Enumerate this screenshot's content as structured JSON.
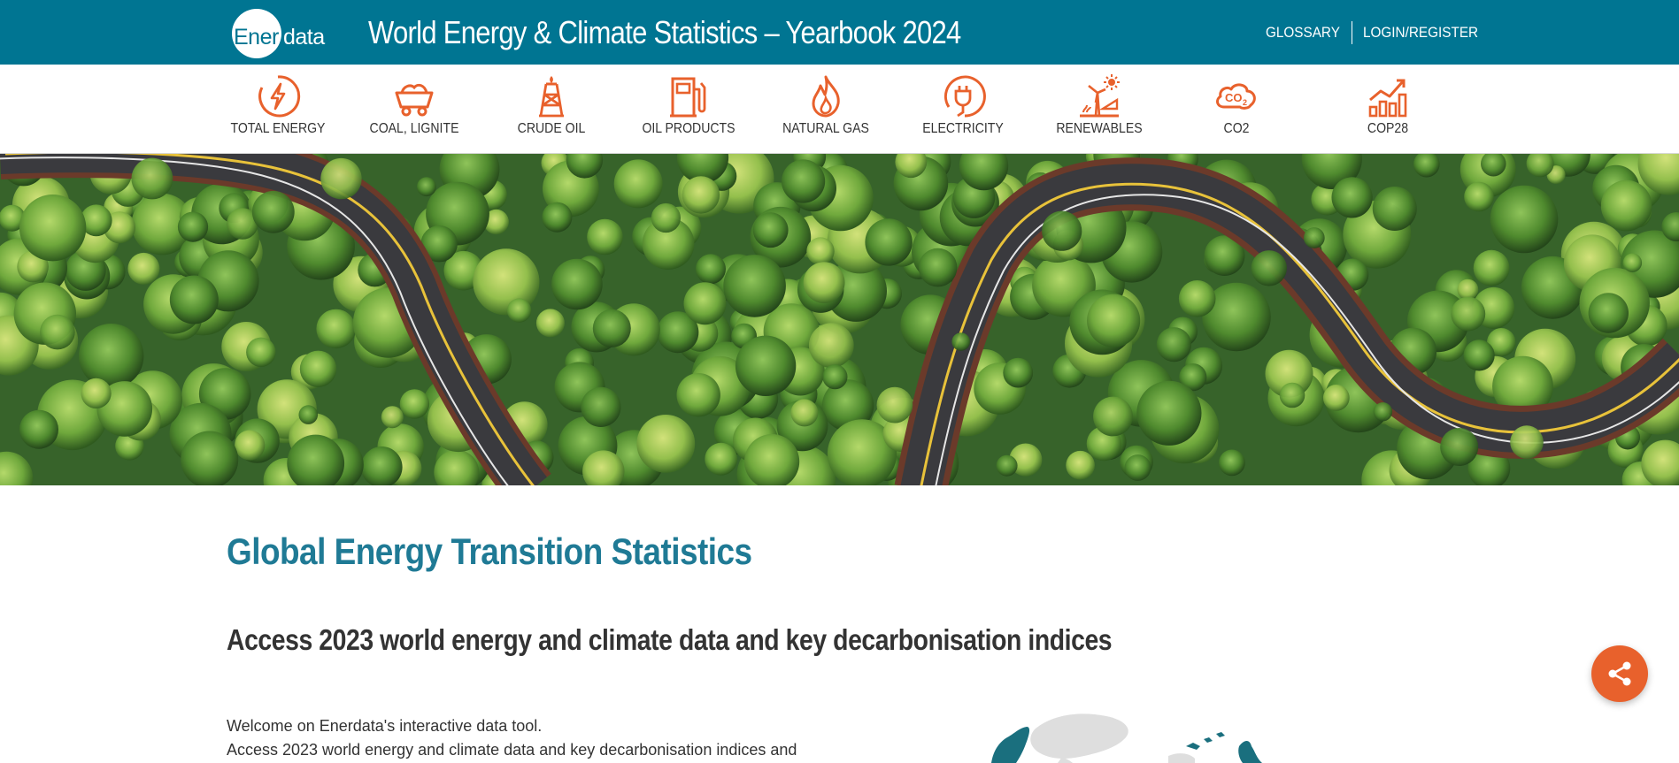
{
  "header": {
    "logo": {
      "text_left": "Ener",
      "text_right": "data"
    },
    "title": "World Energy & Climate Statistics – Yearbook 2024",
    "links": [
      {
        "label": "GLOSSARY"
      },
      {
        "label": "LOGIN/REGISTER"
      }
    ]
  },
  "categories": [
    {
      "label": "TOTAL ENERGY",
      "icon": "lightning-circle-icon"
    },
    {
      "label": "COAL, LIGNITE",
      "icon": "mine-cart-icon"
    },
    {
      "label": "CRUDE OIL",
      "icon": "oil-derrick-icon"
    },
    {
      "label": "OIL PRODUCTS",
      "icon": "fuel-pump-icon"
    },
    {
      "label": "NATURAL GAS",
      "icon": "flame-icon"
    },
    {
      "label": "ELECTRICITY",
      "icon": "plug-icon"
    },
    {
      "label": "RENEWABLES",
      "icon": "wind-solar-icon"
    },
    {
      "label": "CO2",
      "icon": "co2-cloud-icon"
    },
    {
      "label": "COP28",
      "icon": "growth-chart-icon"
    }
  ],
  "main": {
    "heading": "Global Energy Transition Statistics",
    "subheading": "Access 2023 world energy and climate data and key decarbonisation indices",
    "intro_line1": "Welcome on Enerdata's interactive data tool.",
    "intro_line2": "Access 2023 world energy and climate data and key decarbonisation indices and"
  },
  "colors": {
    "header_bg": "#007592",
    "accent_orange": "#e8612c",
    "heading_blue": "#1f7a95",
    "text": "#333333"
  }
}
